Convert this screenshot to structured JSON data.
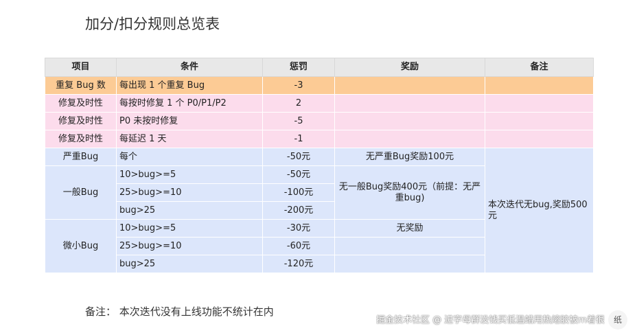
{
  "title": "加分/扣分规则总览表",
  "table": {
    "headers": [
      "项目",
      "条件",
      "惩罚",
      "奖励",
      "备注"
    ],
    "rows": [
      {
        "item": "重复 Bug 数",
        "condition": "每出现 1 个重复 Bug",
        "penalty": "-3",
        "reward": "",
        "remark": ""
      },
      {
        "item": "修复及时性",
        "condition": "每按时修复 1 个 P0/P1/P2",
        "penalty": "2",
        "reward": "",
        "remark": ""
      },
      {
        "item": "修复及时性",
        "condition": "P0 未按时修复",
        "penalty": "-5",
        "reward": "",
        "remark": ""
      },
      {
        "item": "修复及时性",
        "condition": "每延迟 1 天",
        "penalty": "-1",
        "reward": "",
        "remark": ""
      }
    ],
    "severe": {
      "item": "严重Bug",
      "condition": "每个",
      "penalty": "-50元",
      "reward": "无严重Bug奖励100元"
    },
    "normal": {
      "item": "一般Bug",
      "conditions": [
        "10>bug>=5",
        "25>bug>=10",
        "bug>25"
      ],
      "penalties": [
        "-50元",
        "-100元",
        "-200元"
      ],
      "reward": "无一般Bug奖励400元（前提：无严重bug)"
    },
    "minor": {
      "item": "微小Bug",
      "conditions": [
        "10>bug>=5",
        "25>bug>=10",
        "bug>25"
      ],
      "penalties": [
        "-30元",
        "-60元",
        "-120元"
      ],
      "reward": "无奖励"
    },
    "bug_remark": "本次迭代无bug,奖励500元"
  },
  "note": "备注：  本次迭代没有上线功能不统计在内",
  "watermark": "掘金技术社区 @ 进字母群没钱买低温蜡用热熔胶被m着很",
  "corner_label": "纸"
}
